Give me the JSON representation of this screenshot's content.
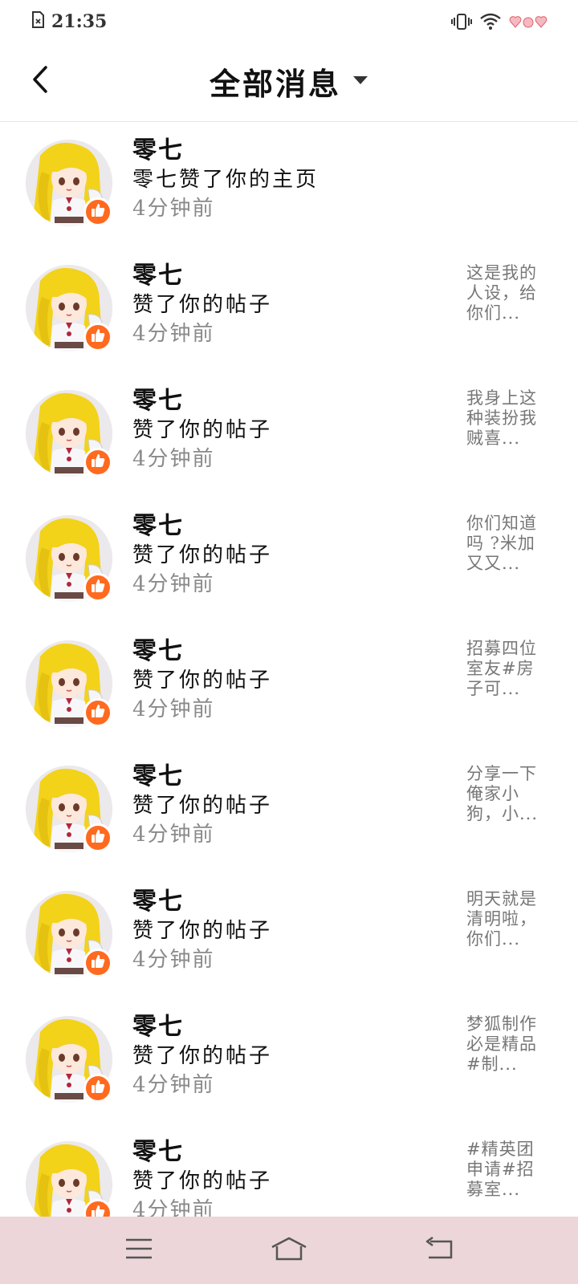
{
  "status_bar": {
    "time": "21:35",
    "icons": [
      "no-sim-icon",
      "vibrate-icon",
      "wifi-icon",
      "battery-hearts-icon"
    ]
  },
  "header": {
    "back_icon": "chevron-left-icon",
    "title": "全部消息",
    "dropdown_icon": "caret-down-icon"
  },
  "messages": [
    {
      "name": "零七",
      "action": "零七赞了你的主页",
      "time": "4分钟前",
      "preview": ""
    },
    {
      "name": "零七",
      "action": "赞了你的帖子",
      "time": "4分钟前",
      "preview": "这是我的人设，给你们..."
    },
    {
      "name": "零七",
      "action": "赞了你的帖子",
      "time": "4分钟前",
      "preview": "我身上这种装扮我贼喜..."
    },
    {
      "name": "零七",
      "action": "赞了你的帖子",
      "time": "4分钟前",
      "preview": "你们知道吗 ?米加又又..."
    },
    {
      "name": "零七",
      "action": "赞了你的帖子",
      "time": "4分钟前",
      "preview": "招募四位室友#房子可..."
    },
    {
      "name": "零七",
      "action": "赞了你的帖子",
      "time": "4分钟前",
      "preview": "分享一下俺家小狗，小..."
    },
    {
      "name": "零七",
      "action": "赞了你的帖子",
      "time": "4分钟前",
      "preview": "明天就是清明啦，你们..."
    },
    {
      "name": "零七",
      "action": "赞了你的帖子",
      "time": "4分钟前",
      "preview": "梦狐制作必是精品#制..."
    },
    {
      "name": "零七",
      "action": "赞了你的帖子",
      "time": "4分钟前",
      "preview": "#精英团申请#招募室..."
    }
  ],
  "nav_bar": {
    "icons": [
      "menu-icon",
      "home-icon",
      "back-icon"
    ]
  },
  "colors": {
    "badge": "#ff6a1f",
    "nav_background": "#ecd6da",
    "secondary_text": "#8a8a8a"
  }
}
